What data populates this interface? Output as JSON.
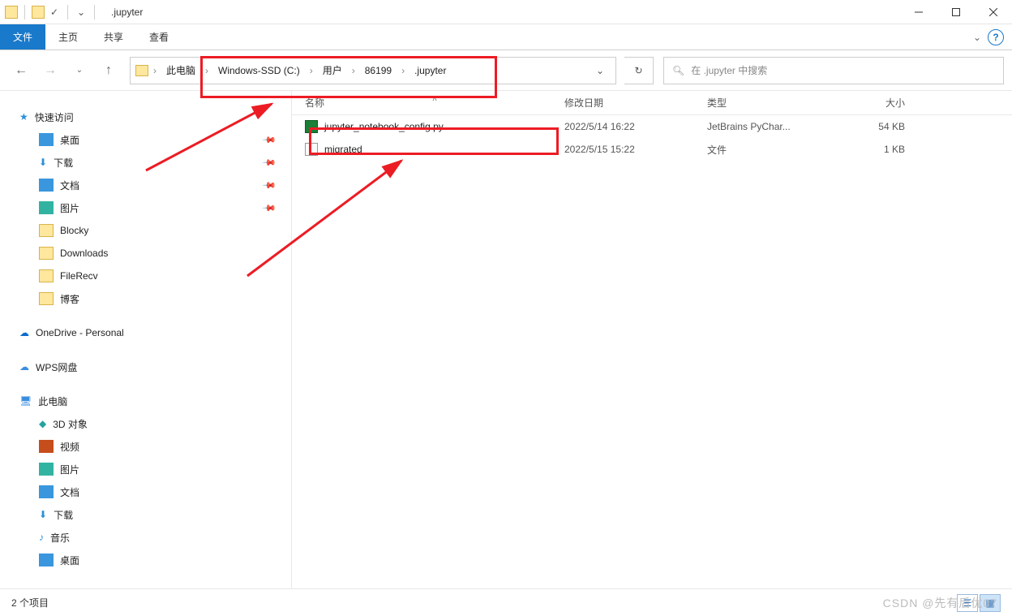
{
  "window": {
    "title": ".jupyter"
  },
  "ribbon": {
    "file": "文件",
    "home": "主页",
    "share": "共享",
    "view": "查看"
  },
  "breadcrumb": {
    "root": "此电脑",
    "p1": "Windows-SSD (C:)",
    "p2": "用户",
    "p3": "86199",
    "p4": ".jupyter"
  },
  "search": {
    "placeholder": "在 .jupyter 中搜索"
  },
  "columns": {
    "name": "名称",
    "date": "修改日期",
    "type": "类型",
    "size": "大小"
  },
  "files": [
    {
      "name": "jupyter_notebook_config.py",
      "date": "2022/5/14 16:22",
      "type": "JetBrains PyChar...",
      "size": "54 KB",
      "icon": "py"
    },
    {
      "name": "migrated",
      "date": "2022/5/15 15:22",
      "type": "文件",
      "size": "1 KB",
      "icon": "file"
    }
  ],
  "sidebar": {
    "quick_access": "快速访问",
    "desktop": "桌面",
    "downloads": "下载",
    "documents": "文档",
    "pictures": "图片",
    "blocky": "Blocky",
    "downloads_en": "Downloads",
    "filerecv": "FileRecv",
    "blog": "博客",
    "onedrive": "OneDrive - Personal",
    "wps": "WPS网盘",
    "thispc": "此电脑",
    "3d": "3D 对象",
    "videos": "视频",
    "pictures2": "图片",
    "documents2": "文档",
    "downloads2": "下载",
    "music": "音乐",
    "desktop2": "桌面"
  },
  "status": {
    "items": "2 个项目"
  },
  "watermark": "CSDN @先有后优07"
}
